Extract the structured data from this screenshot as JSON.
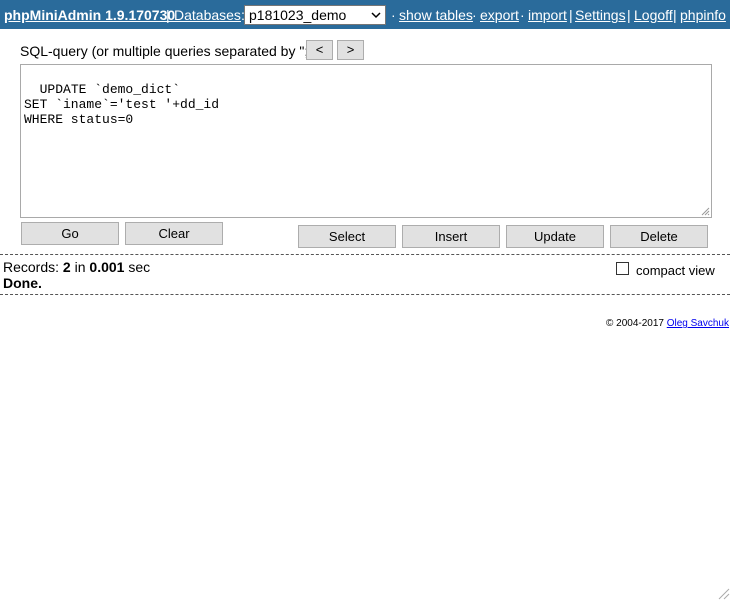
{
  "header": {
    "brand": "phpMiniAdmin 1.9.170730",
    "databases_label": "Databases",
    "databases_colon": ":",
    "db_selected": "p181023_demo",
    "links": {
      "show_tables": "show tables",
      "export": "export",
      "import": "import",
      "settings": "Settings",
      "logoff": "Logoff",
      "phpinfo": "phpinfo"
    }
  },
  "query": {
    "label": "SQL-query (or multiple queries separated by \";\"):",
    "prev": "<",
    "next": ">",
    "text": "UPDATE `demo_dict`\nSET `iname`='test '+dd_id\nWHERE status=0"
  },
  "buttons": {
    "go": "Go",
    "clear": "Clear",
    "select": "Select",
    "insert": "Insert",
    "update": "Update",
    "delete": "Delete"
  },
  "status": {
    "records_prefix": "Records: ",
    "records_count": "2",
    "in": " in ",
    "time": "0.001",
    "unit": " sec",
    "done": "Done.",
    "compact_view": "compact view",
    "compact_checked": false
  },
  "footer": {
    "copyright": "© 2004-2017 ",
    "author": "Oleg Savchuk"
  },
  "colors": {
    "header_bg": "#2a6b9b"
  }
}
